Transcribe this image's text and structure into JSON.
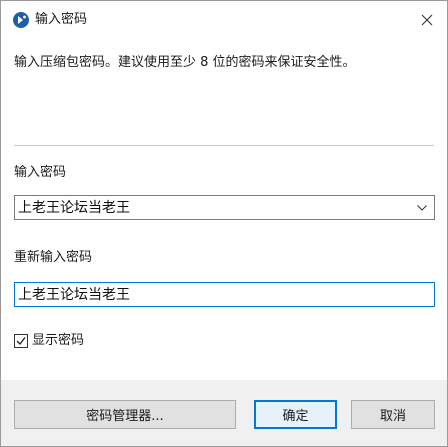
{
  "window": {
    "title": "输入密码",
    "app_icon": "app-logo-icon",
    "close_icon": "close-icon"
  },
  "description": "输入压缩包密码。建议使用至少 8 位的密码来保证安全性。",
  "password_field": {
    "label": "输入密码",
    "value": "上老王论坛当老王",
    "dropdown_icon": "chevron-down-icon"
  },
  "confirm_field": {
    "label": "重新输入密码",
    "value": "上老王论坛当老王"
  },
  "show_password": {
    "label": "显示密码",
    "checked": true
  },
  "buttons": {
    "manager": "密码管理器...",
    "ok": "确定",
    "cancel": "取消"
  },
  "colors": {
    "accent": "#0078d7",
    "footer_bg": "#f0f0f0"
  }
}
